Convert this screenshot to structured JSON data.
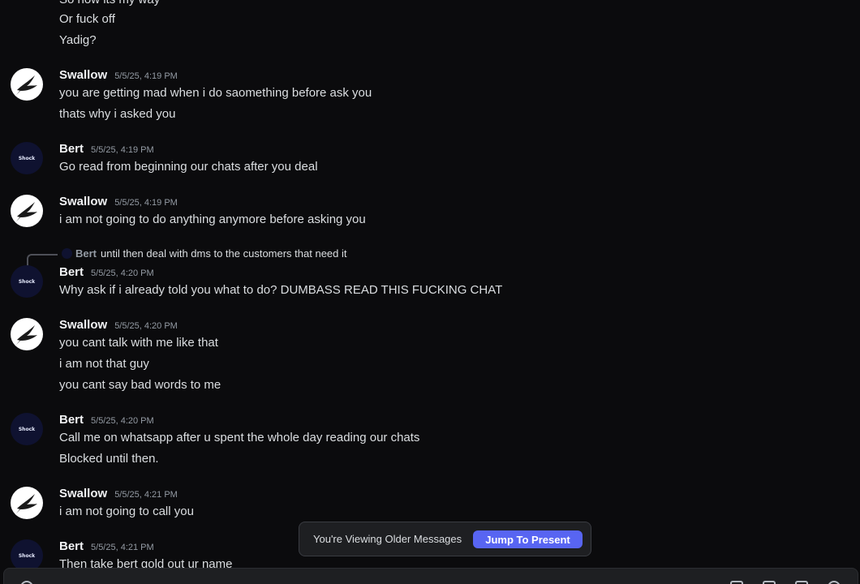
{
  "top_lines": [
    "So now its my way",
    "Or fuck off",
    "Yadig?"
  ],
  "messages": [
    {
      "author": "Swallow",
      "timestamp": "5/5/25, 4:19 PM",
      "lines": [
        "you are getting mad when i do saomething before ask you",
        "thats why i asked you"
      ]
    },
    {
      "author": "Bert",
      "timestamp": "5/5/25, 4:19 PM",
      "lines": [
        "Go read from beginning our chats after you deal"
      ]
    },
    {
      "author": "Swallow",
      "timestamp": "5/5/25, 4:19 PM",
      "lines": [
        "i am not going to do anything anymore before asking you"
      ]
    },
    {
      "author": "Bert",
      "timestamp": "5/5/25, 4:20 PM",
      "lines": [
        "Why ask if i already told you what to do? DUMBASS READ THIS FUCKING CHAT"
      ]
    },
    {
      "author": "Swallow",
      "timestamp": "5/5/25, 4:20 PM",
      "lines": [
        "you cant talk with me like that",
        "i am not that guy",
        "you cant say bad words to me"
      ]
    },
    {
      "author": "Bert",
      "timestamp": "5/5/25, 4:20 PM",
      "lines": [
        "Call me on whatsapp after u spent the whole day reading our chats",
        "Blocked until then."
      ]
    },
    {
      "author": "Swallow",
      "timestamp": "5/5/25, 4:21 PM",
      "lines": [
        "i am not going to call you"
      ]
    },
    {
      "author": "Bert",
      "timestamp": "5/5/25, 4:21 PM",
      "lines": [
        "Then take bert gold out ur name"
      ]
    }
  ],
  "reply": {
    "author": "Bert",
    "text": "until then deal with dms to the customers that need it"
  },
  "avatar_logo_text": "Shock",
  "older_banner": {
    "text": "You're Viewing Older Messages",
    "button": "Jump To Present"
  },
  "colors": {
    "background": "#0b0b0d",
    "accent": "#5865f2",
    "timestamp": "#949ba4"
  }
}
